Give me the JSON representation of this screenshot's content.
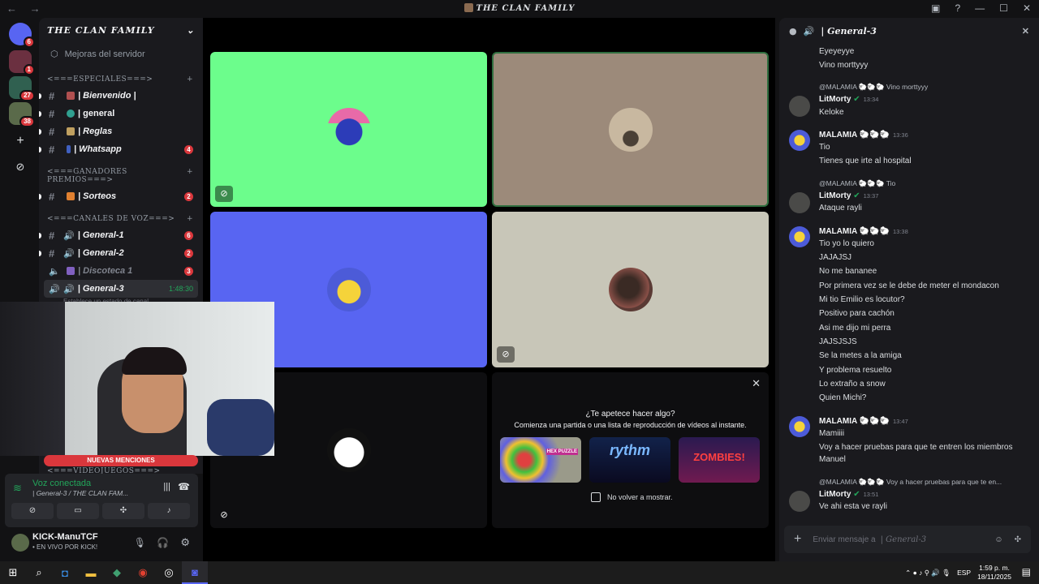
{
  "window": {
    "title": "THE CLAN FAMILY"
  },
  "guilds": [
    {
      "name": "discord-home",
      "badge": "6"
    },
    {
      "name": "server-1",
      "badge": "1"
    },
    {
      "name": "server-2",
      "badge": "27"
    },
    {
      "name": "server-3",
      "badge": "38"
    }
  ],
  "server": {
    "name": "THE CLAN FAMILY",
    "boost": "Mejoras del servidor",
    "categories": {
      "especiales": "<===ESPECIALES===>",
      "ganadores": "<===GANADORES PREMIOS===>",
      "voz": "<===CANALES DE VOZ===>",
      "videojuegos": "<===VIDEOJUEGOS===>"
    },
    "channels": [
      {
        "label": "| Bienvenido |",
        "badge": ""
      },
      {
        "label": "| general",
        "badge": ""
      },
      {
        "label": "| Reglas",
        "badge": ""
      },
      {
        "label": "| Whatsapp",
        "badge": "4"
      },
      {
        "label": "| Sorteos",
        "badge": "2"
      },
      {
        "label": "| General-1",
        "badge": "6"
      },
      {
        "label": "| General-2",
        "badge": "2"
      },
      {
        "label": "| Discoteca 1",
        "badge": "3"
      },
      {
        "label": "| General-3",
        "time": "1:48:30"
      }
    ],
    "status_hint": "Establece un estado de canal"
  },
  "overlay": {
    "new_mentions": "NUEVAS MENCIONES"
  },
  "voice_panel": {
    "status": "Voz conectada",
    "channel": "| General-3 / THE CLAN FAM..."
  },
  "user": {
    "name": "KICK-ManuTCF",
    "status": "• EN VIVO POR KICK!"
  },
  "activity": {
    "title": "¿Te apetece hacer algo?",
    "subtitle": "Comienza una partida o una lista de reproducción de vídeos al instante.",
    "checkbox": "No volver a mostrar.",
    "cards": [
      "HEX PUZZLE",
      "rythm",
      "ZOMBIES!"
    ]
  },
  "chat": {
    "title": "| General-3",
    "placeholder": "Enviar mensaje a",
    "placeholder_channel": "| General-3",
    "lines": [
      "Eyeyeyye",
      "Vino morttyyy"
    ],
    "m1": {
      "reply": "@MALAMIA 🐑🐑🐑 Vino morttyyy",
      "author": "LitMorty",
      "time": "13:34",
      "text": "Keloke"
    },
    "m2": {
      "author": "MALAMIA 🐑🐑🐑",
      "time": "13:36",
      "lines": [
        "Tio",
        "Tienes que irte al hospital"
      ]
    },
    "m3": {
      "reply": "@MALAMIA 🐑🐑🐑 Tio",
      "author": "LitMorty",
      "time": "13:37",
      "text": "Ataque rayli"
    },
    "m4": {
      "author": "MALAMIA 🐑🐑🐑",
      "time": "13:38",
      "lines": [
        "Tio yo lo quiero",
        "JAJAJSJ",
        "No me bananee",
        "Por primera vez se le debe de meter el mondacon",
        "Mi tio Emilio es locutor?",
        "Positivo para cachón",
        "Asi me dijo mi perra",
        "JAJSJSJS",
        "Se la metes a la amiga",
        "Y problema resuelto",
        "Lo extraño a snow",
        "Quien Michi?"
      ]
    },
    "m5": {
      "author": "MALAMIA 🐑🐑🐑",
      "time": "13:47",
      "lines": [
        "Mamiiii",
        "Voy a hacer pruebas para que te entren los miembros",
        "Manuel"
      ]
    },
    "m6": {
      "reply": "@MALAMIA 🐑🐑🐑 Voy a hacer pruebas para que te en...",
      "author": "LitMorty",
      "time": "13:51",
      "text": "Ve ahi esta ve rayli"
    }
  },
  "taskbar": {
    "lang": "ESP",
    "time": "1:59 p. m.",
    "date": "18/11/2025"
  },
  "colors": {
    "accent": "#5865f2",
    "green_tile": "#6fff8f",
    "blue_tile": "#5865f2",
    "online": "#23a55a",
    "danger": "#da373c"
  }
}
